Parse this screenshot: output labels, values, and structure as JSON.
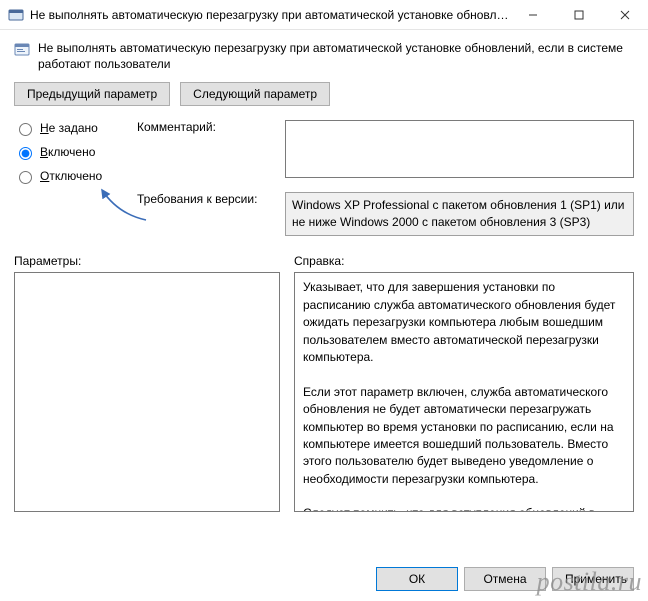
{
  "window": {
    "title": "Не выполнять автоматическую перезагрузку при автоматической установке обновлений, е..."
  },
  "heading": "Не выполнять автоматическую перезагрузку при автоматической установке обновлений, если в системе работают пользователи",
  "nav": {
    "prev": "Предыдущий параметр",
    "next": "Следующий параметр"
  },
  "radios": {
    "not_configured": "Не задано",
    "enabled": "Включено",
    "disabled": "Отключено",
    "selected": "enabled"
  },
  "labels": {
    "comment": "Комментарий:",
    "requirements": "Требования к версии:",
    "options": "Параметры:",
    "help": "Справка:"
  },
  "comment_value": "",
  "requirements_text": "Windows XP Professional с пакетом обновления 1 (SP1) или не ниже Windows 2000 с пакетом обновления 3 (SP3)",
  "options_text": "",
  "help_text": "Указывает, что для завершения установки по расписанию служба автоматического обновления будет ожидать перезагрузки компьютера любым вошедшим пользователем вместо автоматической перезагрузки компьютера.\n\nЕсли этот параметр включен, служба автоматического обновления не будет автоматически перезагружать компьютер во время установки по расписанию, если на компьютере имеется вошедший пользователь. Вместо этого пользователю будет выведено уведомление о необходимости перезагрузки компьютера.\n\nСледует помнить, что для вступления обновлений в действие необходимо перезагрузить компьютер.\n\nЕсли этот параметр отключен или не задан, пользователю",
  "footer": {
    "ok": "ОК",
    "cancel": "Отмена",
    "apply": "Применить"
  },
  "watermark": "postila.ru"
}
